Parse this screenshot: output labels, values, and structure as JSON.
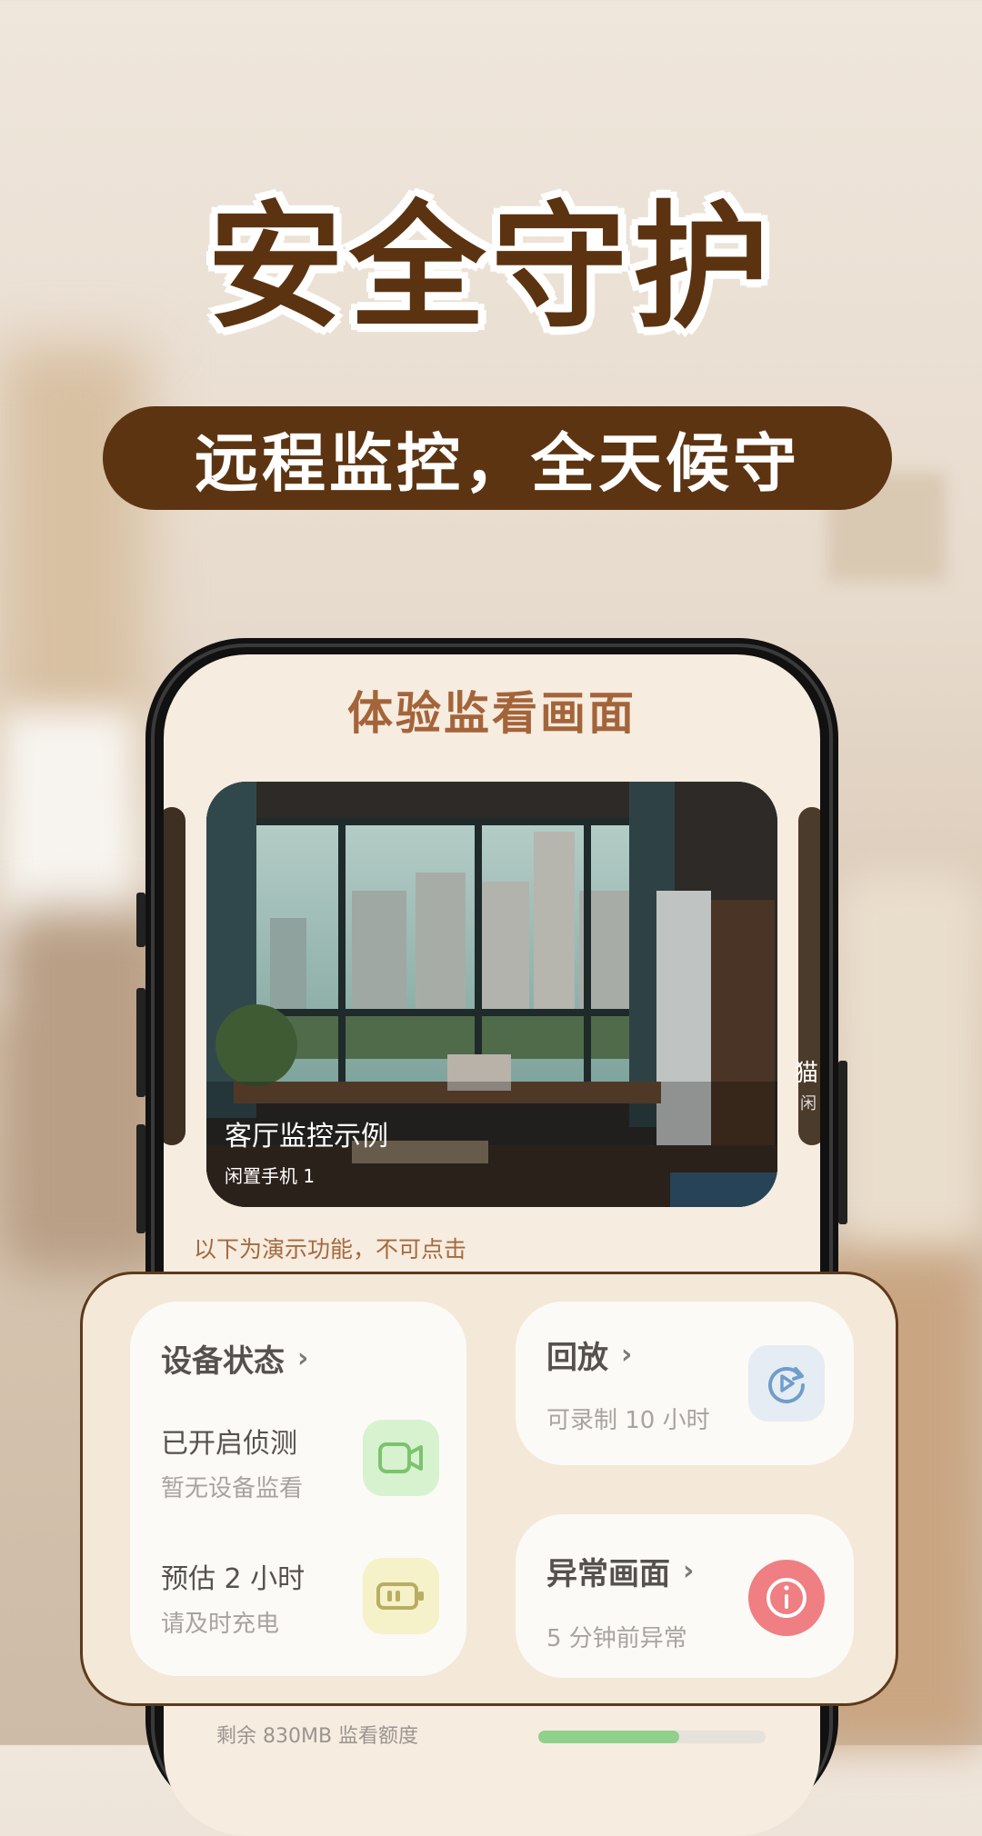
{
  "headline": "安全守护",
  "subtitle": "远程监控，全天候守",
  "screen": {
    "title": "体验监看画面",
    "camera": {
      "title": "客厅监控示例",
      "subtitle": "闲置手机 1"
    },
    "peek_right_label": "猫",
    "peek_right_sub": "闲",
    "demo_note": "以下为演示功能，不可点击",
    "footer": {
      "quota_text": "剩余 830MB 监看额度",
      "quota_fraction": 0.62
    }
  },
  "panel": {
    "device_status": {
      "title": "设备状态",
      "rows": [
        {
          "main": "已开启侦测",
          "sub": "暂无设备监看",
          "icon": "video-camera-icon",
          "icon_bg": "#d7f2cf",
          "icon_color": "#7bc46e"
        },
        {
          "main": "预估 2 小时",
          "sub": "请及时充电",
          "icon": "battery-icon",
          "icon_bg": "#f5f1c9",
          "icon_color": "#b9ad62"
        }
      ]
    },
    "playback": {
      "title": "回放",
      "sub": "可录制 10 小时",
      "icon": "replay-icon",
      "icon_bg": "#e6ecf3",
      "icon_color": "#6f9ec9"
    },
    "anomaly": {
      "title": "异常画面",
      "sub": "5 分钟前异常",
      "icon": "alert-icon",
      "icon_bg": "#ef7f82"
    }
  },
  "colors": {
    "brand_brown": "#5c3310",
    "title_brown": "#a4643a",
    "panel_bg": "#f4e8d8"
  }
}
